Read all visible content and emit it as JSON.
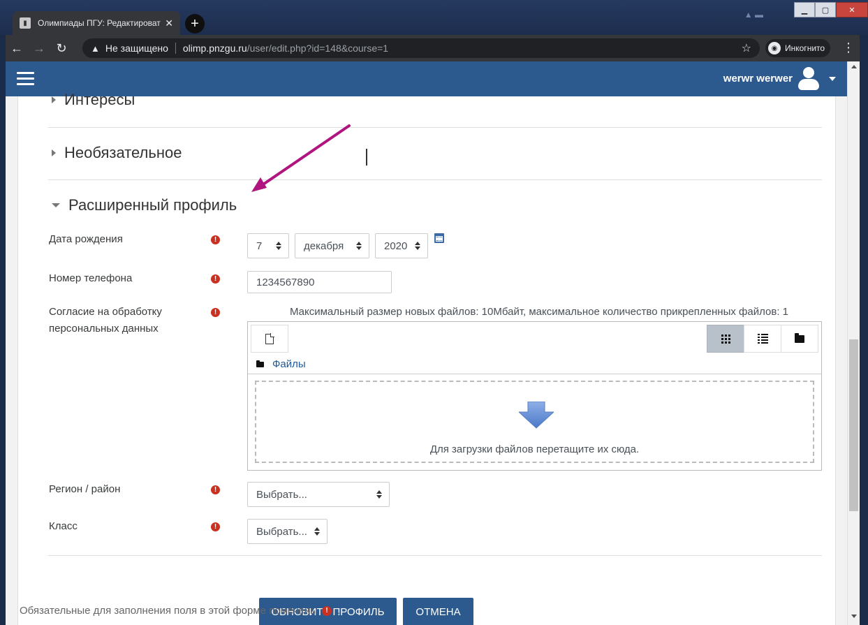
{
  "browser": {
    "tab_title": "Олимпиады ПГУ: Редактироват",
    "tab_close": "✕",
    "new_tab": "+",
    "security_label": "Не защищено",
    "url_host": "olimp.pnzgu.ru",
    "url_path": "/user/edit.php?id=148&course=1",
    "incognito_label": "Инкогнито"
  },
  "navbar": {
    "user_name": "werwr werwer"
  },
  "sections": {
    "interests": "Интересы",
    "optional": "Необязательное",
    "extended_profile": "Расширенный профиль"
  },
  "form": {
    "birthdate": {
      "label": "Дата рождения",
      "day": "7",
      "month": "декабря",
      "year": "2020"
    },
    "phone": {
      "label": "Номер телефона",
      "value": "1234567890"
    },
    "consent": {
      "label_line1": "Согласие на обработку",
      "label_line2": "персональных данных",
      "max_info": "Максимальный размер новых файлов: 10Мбайт, максимальное количество прикрепленных файлов: 1",
      "path_label": "Файлы",
      "drop_text": "Для загрузки файлов перетащите их сюда."
    },
    "region": {
      "label": "Регион / район",
      "value": "Выбрать..."
    },
    "grade": {
      "label": "Класс",
      "value": "Выбрать..."
    },
    "required_mark": "!"
  },
  "buttons": {
    "update": "ОБНОВИТЬ ПРОФИЛЬ",
    "cancel": "ОТМЕНА"
  },
  "footer": {
    "required_note": "Обязательные для заполнения поля в этой форме помечены",
    "period": "."
  },
  "colors": {
    "brand": "#2d5a8e",
    "required": "#ca3120",
    "annotation": "#b0157f"
  }
}
